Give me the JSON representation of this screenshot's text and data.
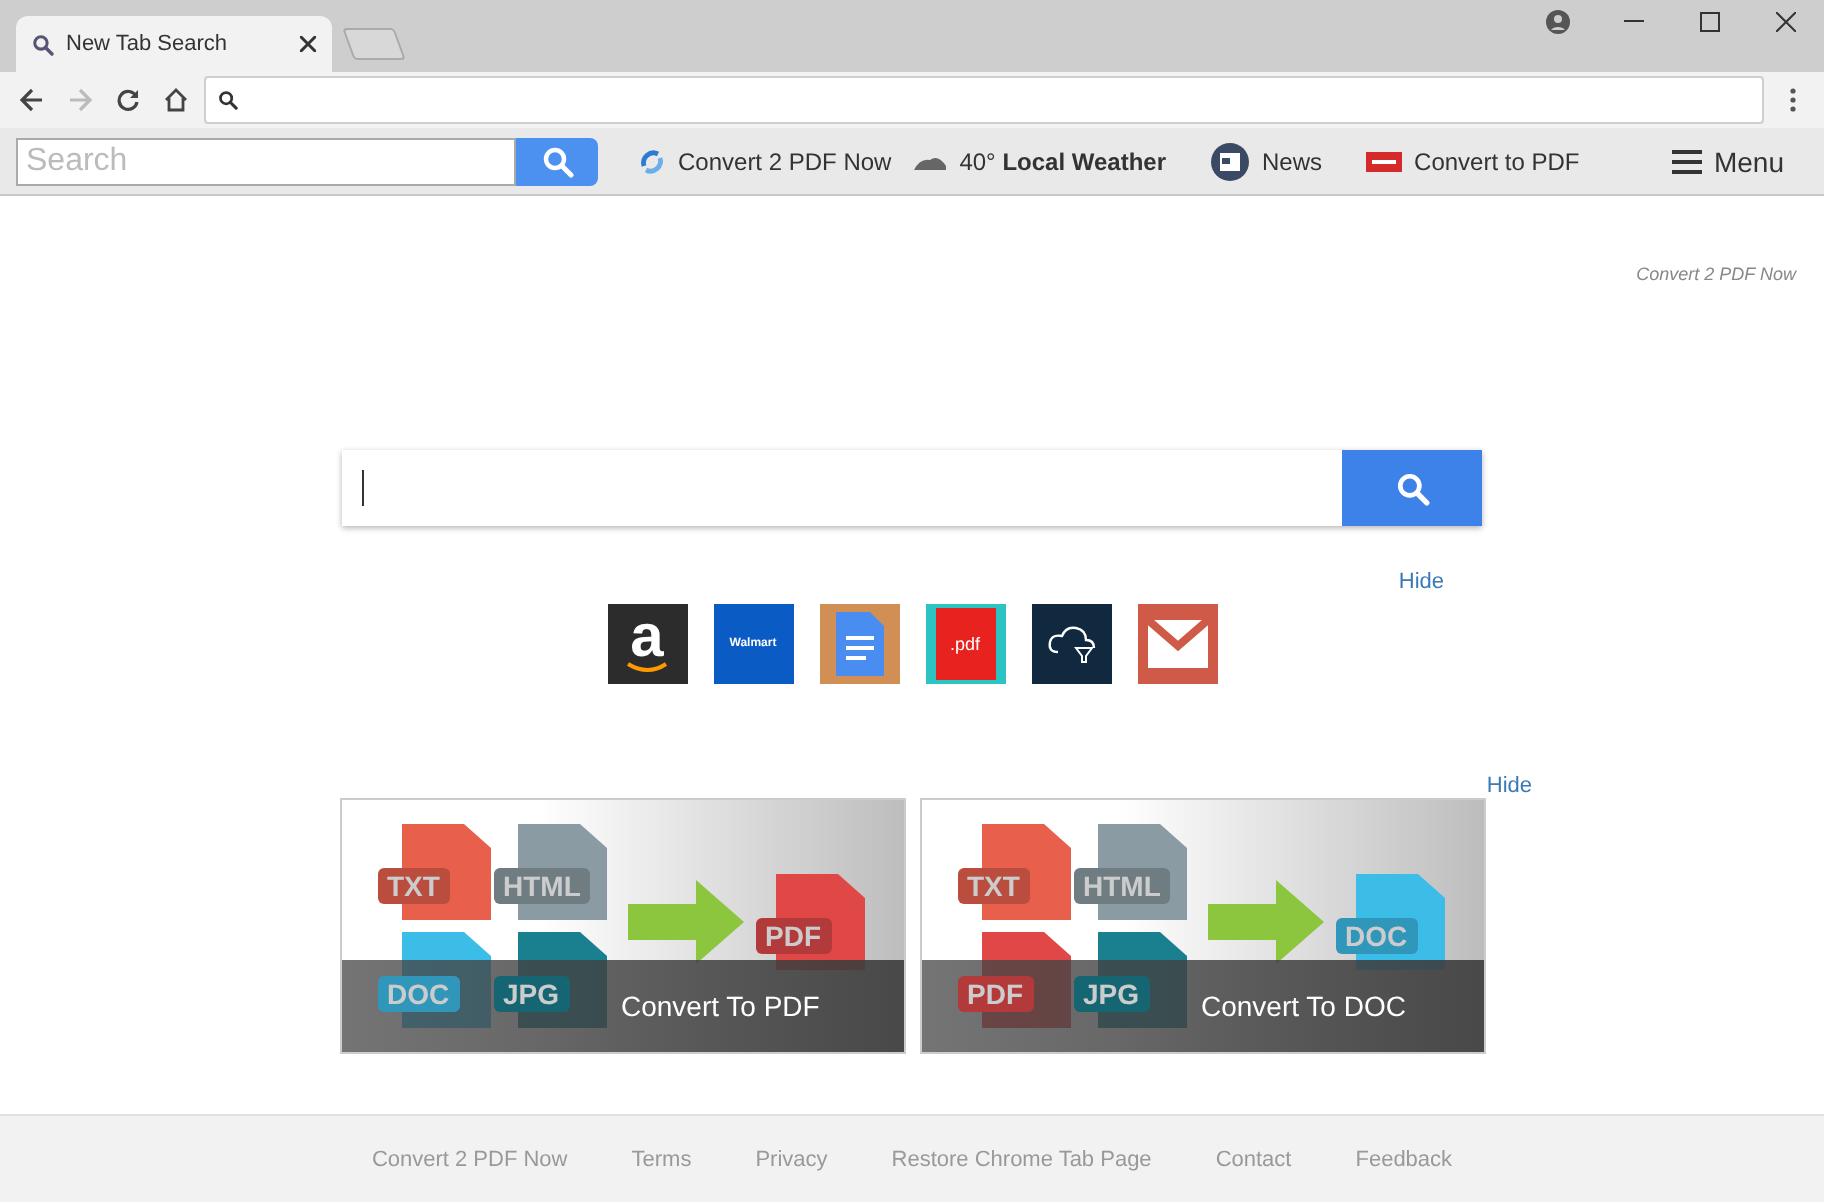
{
  "browser": {
    "tab_title": "New Tab Search"
  },
  "toolbar": {
    "search_placeholder": "Search",
    "links": [
      {
        "kind": "convert",
        "label": "Convert 2 PDF Now"
      },
      {
        "kind": "weather",
        "temp": "40°",
        "label": "Local Weather"
      },
      {
        "kind": "news",
        "label": "News"
      },
      {
        "kind": "pdf",
        "label": "Convert to PDF"
      }
    ],
    "menu": "Menu"
  },
  "brand": "Convert 2 PDF Now",
  "tiles_hide": "Hide",
  "tiles": [
    {
      "kind": "amazon",
      "label": "a"
    },
    {
      "kind": "walmart",
      "label": "Walmart"
    },
    {
      "kind": "docs"
    },
    {
      "kind": "pdf",
      "label": ".pdf"
    },
    {
      "kind": "cloud"
    },
    {
      "kind": "mail"
    }
  ],
  "cards_hide": "Hide",
  "cards": [
    {
      "title": "Convert To PDF",
      "sources": [
        {
          "label": "TXT",
          "color": "#e8604c"
        },
        {
          "label": "HTML",
          "color": "#8b9ba3"
        },
        {
          "label": "DOC",
          "color": "#3cbde8"
        },
        {
          "label": "JPG",
          "color": "#1a7f8e"
        }
      ],
      "target": {
        "label": "PDF",
        "color": "#e04848"
      }
    },
    {
      "title": "Convert To DOC",
      "sources": [
        {
          "label": "TXT",
          "color": "#e8604c"
        },
        {
          "label": "HTML",
          "color": "#8b9ba3"
        },
        {
          "label": "PDF",
          "color": "#e04848"
        },
        {
          "label": "JPG",
          "color": "#1a7f8e"
        }
      ],
      "target": {
        "label": "DOC",
        "color": "#3cbde8"
      }
    }
  ],
  "footer": [
    "Convert 2 PDF Now",
    "Terms",
    "Privacy",
    "Restore Chrome Tab Page",
    "Contact",
    "Feedback"
  ]
}
